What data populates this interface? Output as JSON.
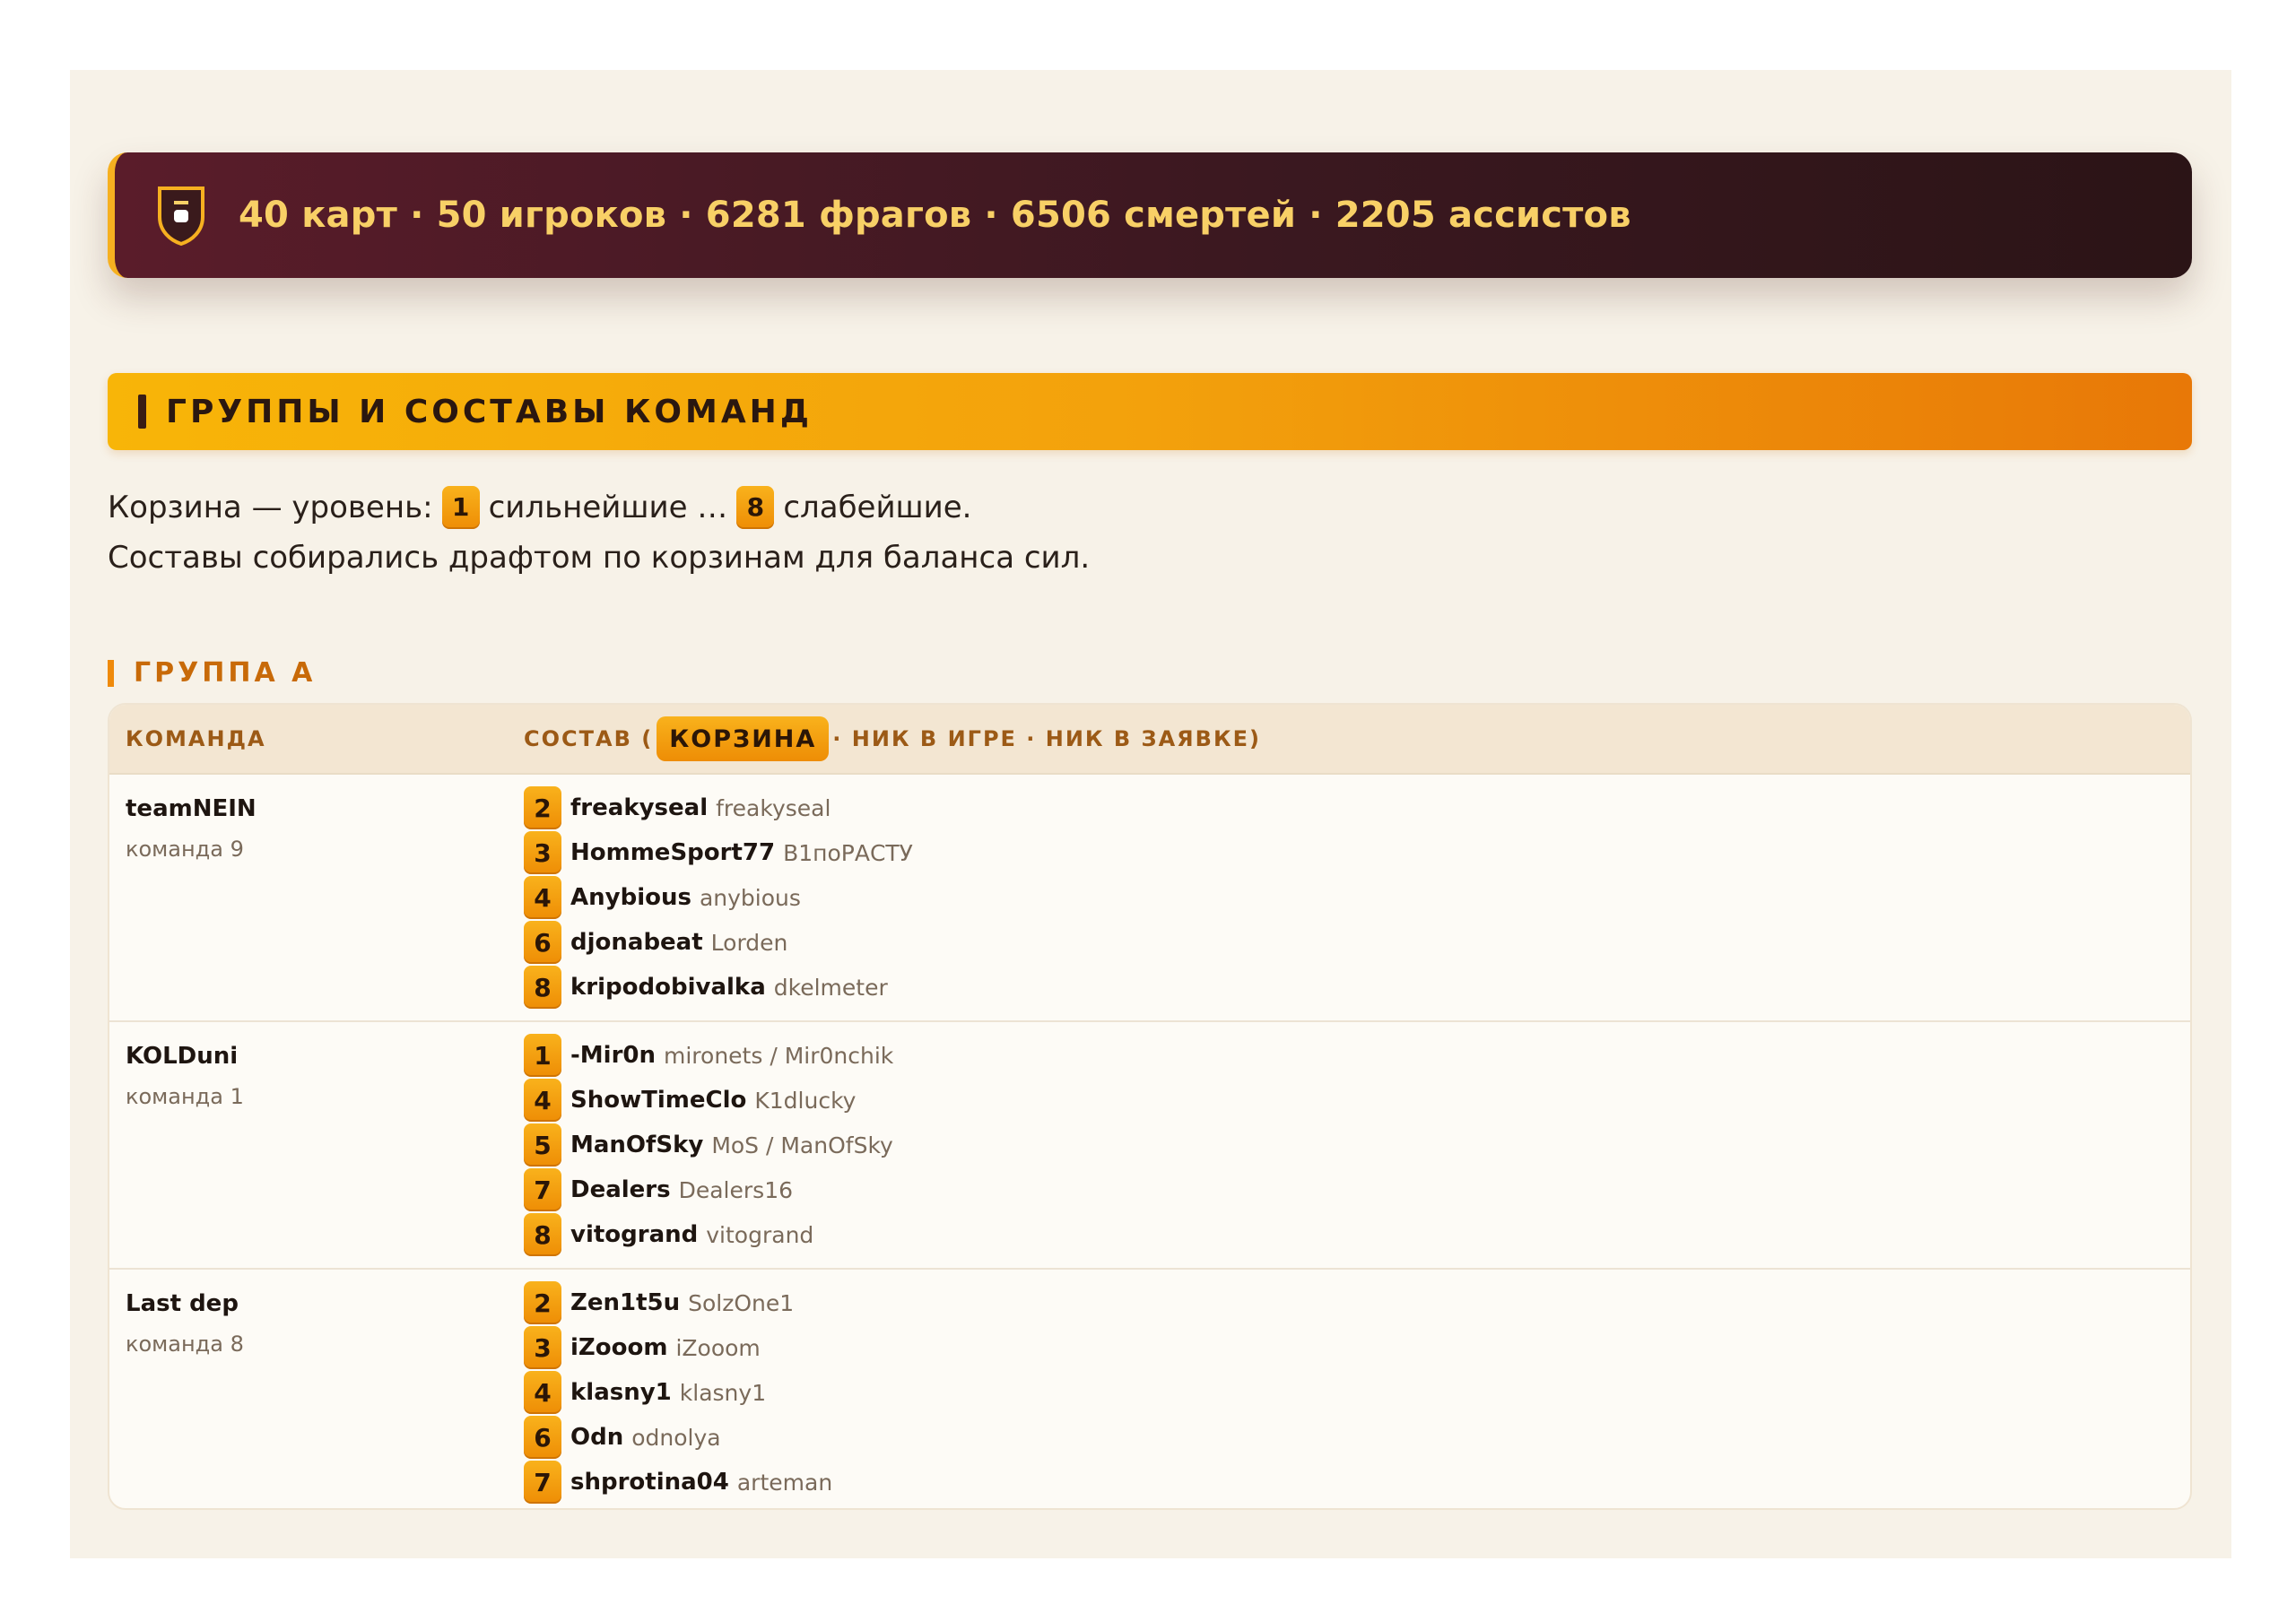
{
  "banner": {
    "stats": "40 карт · 50 игроков · 6281 фрагов · 6506 смертей · 2205 ассистов"
  },
  "section": {
    "title": "ГРУППЫ И СОСТАВЫ КОМАНД"
  },
  "legend": {
    "prefix": "Корзина — уровень:",
    "best_badge": "1",
    "best_text": "сильнейшие …",
    "worst_badge": "8",
    "worst_text": "слабейшие.",
    "line2": "Составы собирались драфтом по корзинам для баланса сил."
  },
  "group": {
    "label": "ГРУППА А",
    "header": {
      "team": "КОМАНДА",
      "roster_open": "СОСТАВ (",
      "roster_chip": "КОРЗИНА",
      "roster_rest": "· НИК В ИГРЕ · НИК В ЗАЯВКЕ)"
    },
    "teams": [
      {
        "name": "teamNEIN",
        "sub": "команда 9",
        "players": [
          {
            "pot": "2",
            "nick": "freakyseal",
            "app": "freakyseal"
          },
          {
            "pot": "3",
            "nick": "HommeSport77",
            "app": "B1поРАСТУ"
          },
          {
            "pot": "4",
            "nick": "Anybious",
            "app": "anybious"
          },
          {
            "pot": "6",
            "nick": "djonabeat",
            "app": "Lorden"
          },
          {
            "pot": "8",
            "nick": "kripodobivalka",
            "app": "dkelmeter"
          }
        ]
      },
      {
        "name": "KOLDuni",
        "sub": "команда 1",
        "players": [
          {
            "pot": "1",
            "nick": "-Mir0n",
            "app": "mironets / Mir0nchik"
          },
          {
            "pot": "4",
            "nick": "ShowTimeClo",
            "app": "K1dlucky"
          },
          {
            "pot": "5",
            "nick": "ManOfSky",
            "app": "MoS / ManOfSky"
          },
          {
            "pot": "7",
            "nick": "Dealers",
            "app": "Dealers16"
          },
          {
            "pot": "8",
            "nick": "vitogrand",
            "app": "vitogrand"
          }
        ]
      },
      {
        "name": "Last dep",
        "sub": "команда 8",
        "players": [
          {
            "pot": "2",
            "nick": "Zen1t5u",
            "app": "SolzOne1"
          },
          {
            "pot": "3",
            "nick": "iZooom",
            "app": "iZooom"
          },
          {
            "pot": "4",
            "nick": "klasny1",
            "app": "klasny1"
          },
          {
            "pot": "6",
            "nick": "Odn",
            "app": "odnolya"
          },
          {
            "pot": "7",
            "nick": "shprotina04",
            "app": "arteman"
          }
        ]
      }
    ]
  }
}
